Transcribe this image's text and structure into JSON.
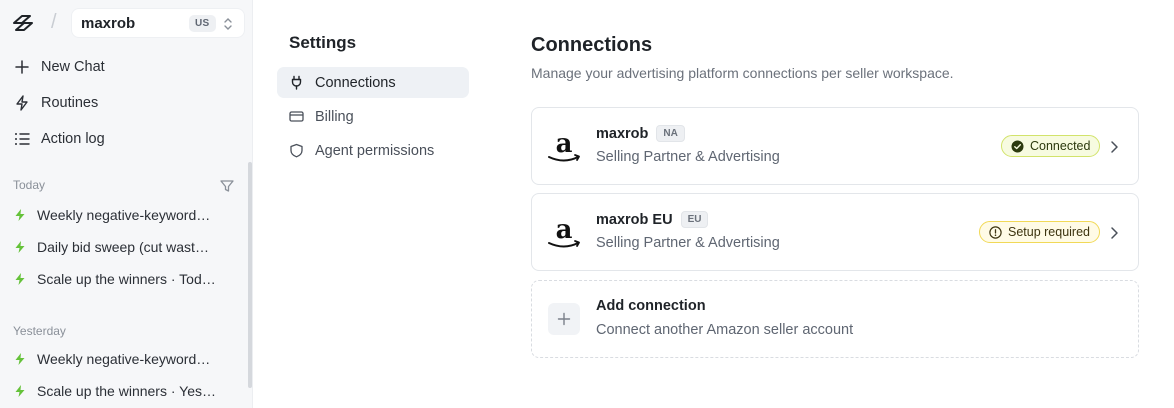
{
  "workspace": {
    "name": "maxrob",
    "region": "US"
  },
  "nav": {
    "new_chat": "New Chat",
    "routines": "Routines",
    "action_log": "Action log"
  },
  "history": {
    "today_label": "Today",
    "yesterday_label": "Yesterday",
    "today": [
      "Weekly negative-keyword…",
      "Daily bid sweep (cut wast…",
      "Scale up the winners · Tod…"
    ],
    "yesterday": [
      "Weekly negative-keyword…",
      "Scale up the winners · Yes…"
    ]
  },
  "settings": {
    "title": "Settings",
    "items": [
      "Connections",
      "Billing",
      "Agent permissions"
    ]
  },
  "main": {
    "title": "Connections",
    "subtitle": "Manage your advertising platform connections per seller workspace.",
    "connections": [
      {
        "name": "maxrob",
        "region": "NA",
        "description": "Selling Partner & Advertising",
        "status": "Connected"
      },
      {
        "name": "maxrob EU",
        "region": "EU",
        "description": "Selling Partner & Advertising",
        "status": "Setup required"
      }
    ],
    "add": {
      "title": "Add connection",
      "description": "Connect another Amazon seller account"
    }
  },
  "colors": {
    "accent_green": "#65c23a",
    "connected_bg": "#f7fbe0",
    "warn_bg": "#fffbe6"
  }
}
